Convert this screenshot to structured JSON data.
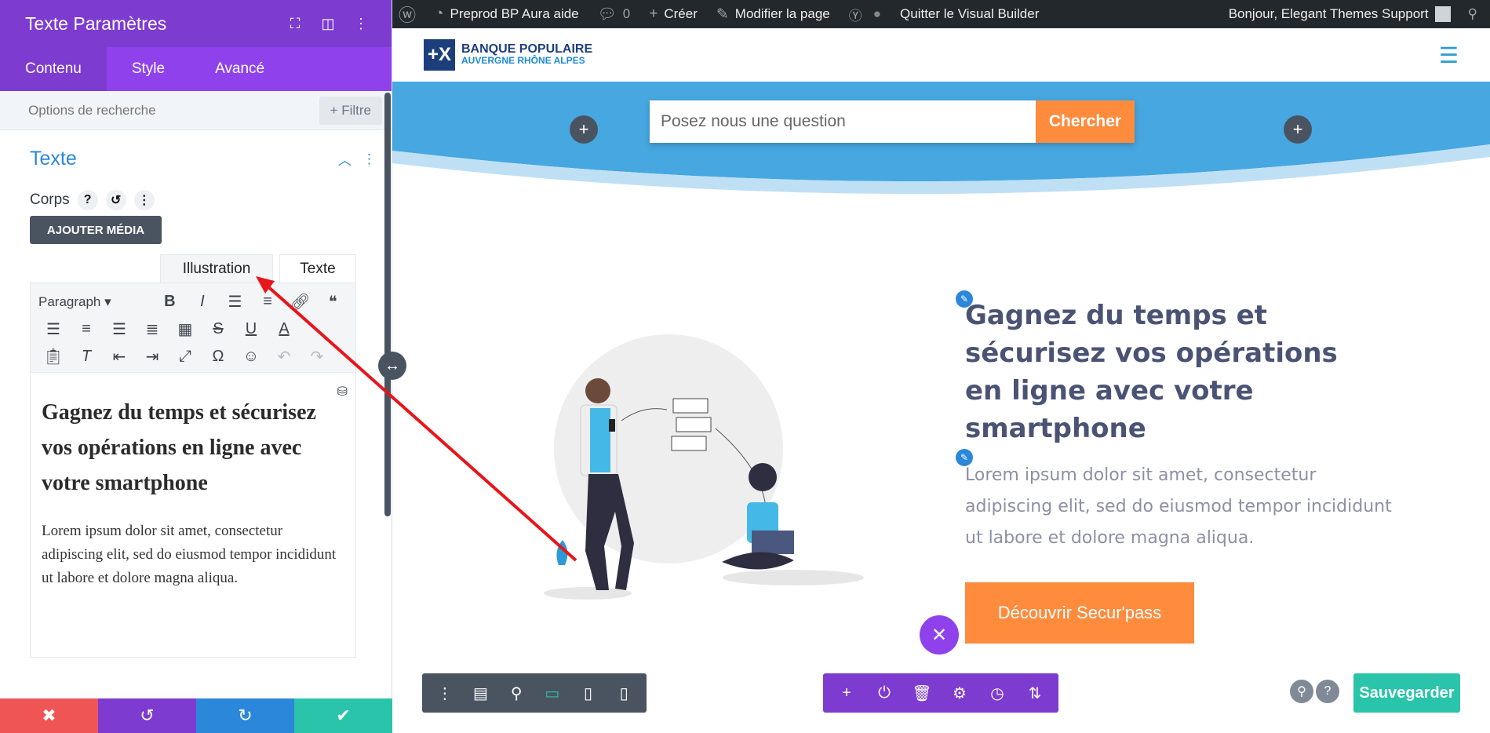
{
  "panel": {
    "title": "Texte Paramètres",
    "tabs": [
      "Contenu",
      "Style",
      "Avancé"
    ],
    "search_placeholder": "Options de recherche",
    "filter_label": "+ Filtre",
    "section_title": "Texte",
    "corps_label": "Corps",
    "add_media_label": "AJOUTER MÉDIA",
    "editor_tabs": [
      "Illustration",
      "Texte"
    ],
    "format_select": "Paragraph",
    "editor_heading": "Gagnez du temps et sécurisez vos opérations en ligne avec votre smartphone",
    "editor_paragraph": "Lorem ipsum dolor sit amet, consectetur adipiscing elit, sed do eiusmod tempor incididunt ut labore et dolore magna aliqua."
  },
  "adminbar": {
    "site_name": "Preprod BP Aura aide",
    "comments_count": "0",
    "create_label": "Créer",
    "edit_page_label": "Modifier la page",
    "quit_builder_label": "Quitter le Visual Builder",
    "greeting": "Bonjour, Elegant Themes Support"
  },
  "site": {
    "logo_line1": "BANQUE POPULAIRE",
    "logo_line2": "AUVERGNE RHÔNE ALPES",
    "search_placeholder": "Posez nous une question",
    "search_button": "Chercher",
    "heading": "Gagnez du temps et sécurisez vos opérations en ligne avec votre smartphone",
    "paragraph": "Lorem ipsum dolor sit amet, consectetur adipiscing elit, sed do eiusmod tempor incididunt ut labore et dolore magna aliqua.",
    "cta_label": "Découvrir Secur'pass"
  },
  "builder": {
    "save_label": "Sauvegarder"
  },
  "colors": {
    "purple": "#7e3bd0",
    "blue": "#2b87da",
    "teal": "#29c4a9",
    "orange": "#ff8b3d",
    "hero_blue": "#47a7e0",
    "arrow_red": "#e8151b"
  }
}
